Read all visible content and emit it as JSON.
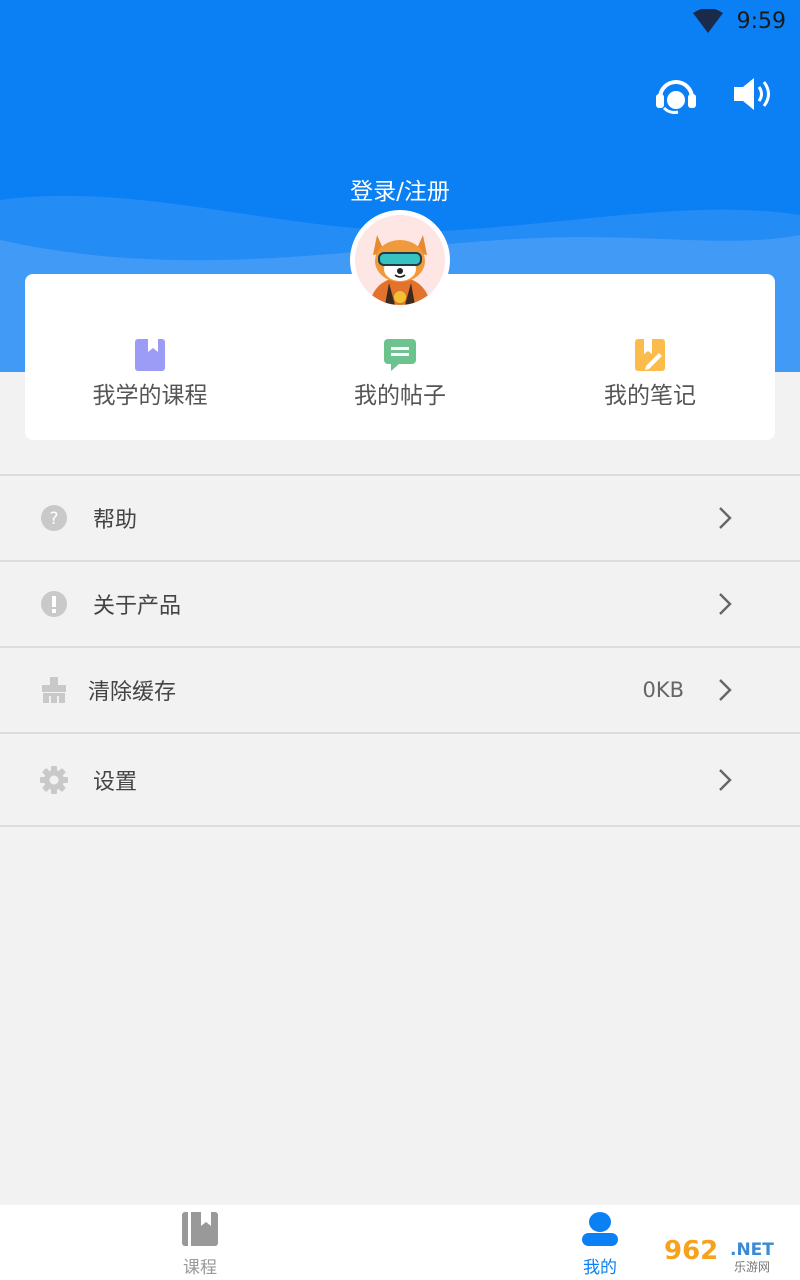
{
  "status_bar": {
    "time": "9:59",
    "wifi_icon": "wifi-icon"
  },
  "header": {
    "bg_color": "#0b80f4",
    "login_text": "登录/注册",
    "support_icon": "headset-icon",
    "sound_icon": "speaker-icon"
  },
  "quick_links": [
    {
      "label": "我学的课程",
      "icon": "course-book-icon",
      "color": "#9c9cf7"
    },
    {
      "label": "我的帖子",
      "icon": "post-chat-icon",
      "color": "#6cc38e"
    },
    {
      "label": "我的笔记",
      "icon": "note-pen-icon",
      "color": "#fbbc4c"
    }
  ],
  "menu": [
    {
      "label": "帮助",
      "icon": "help-icon",
      "value": ""
    },
    {
      "label": "关于产品",
      "icon": "info-icon",
      "value": ""
    },
    {
      "label": "清除缓存",
      "icon": "broom-icon",
      "value": "0KB"
    },
    {
      "label": "设置",
      "icon": "gear-icon",
      "value": ""
    }
  ],
  "bottom_nav": [
    {
      "label": "课程",
      "icon": "book-icon",
      "active": false
    },
    {
      "label": "我的",
      "icon": "person-icon",
      "active": true
    }
  ],
  "colors": {
    "accent": "#0b80f4",
    "inactive": "#999999"
  }
}
